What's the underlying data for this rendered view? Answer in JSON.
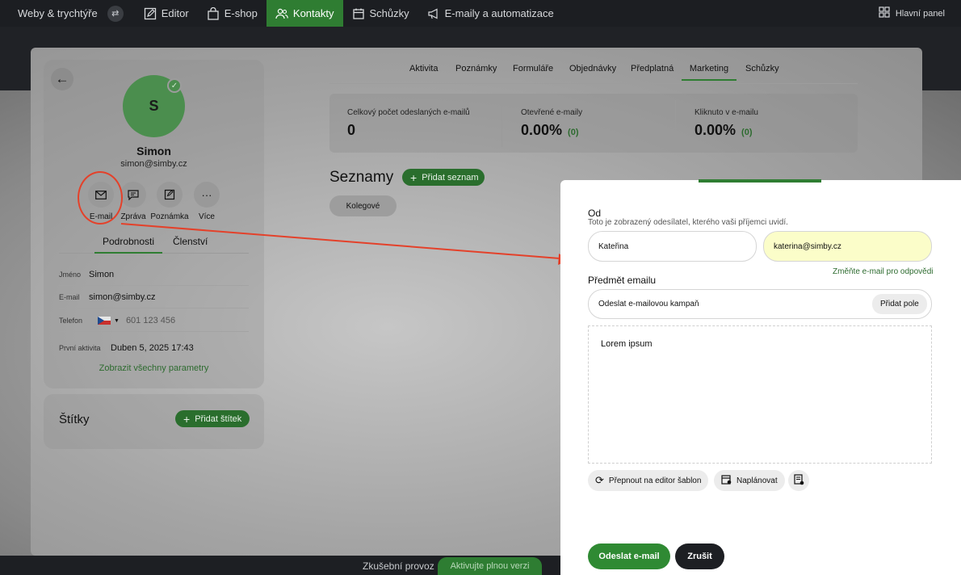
{
  "topbar": {
    "brand": "Weby & trychtýře",
    "nav": [
      {
        "label": "Editor",
        "icon": "edit-icon"
      },
      {
        "label": "E-shop",
        "icon": "shopping-bag-icon"
      },
      {
        "label": "Kontakty",
        "icon": "users-icon",
        "active": true
      },
      {
        "label": "Schůzky",
        "icon": "calendar-icon"
      },
      {
        "label": "E-maily a automatizace",
        "icon": "megaphone-icon"
      }
    ],
    "dashboard_label": "Hlavní panel"
  },
  "contact": {
    "initial": "S",
    "name": "Simon",
    "email": "simon@simby.cz",
    "actions": [
      {
        "label": "E-mail",
        "icon": "mail-icon"
      },
      {
        "label": "Zpráva",
        "icon": "chat-icon"
      },
      {
        "label": "Poznámka",
        "icon": "note-icon"
      },
      {
        "label": "Více",
        "icon": "more-icon"
      }
    ],
    "tabs": [
      "Podrobnosti",
      "Členství"
    ],
    "fields": {
      "name_label": "Jméno",
      "name_value": "Simon",
      "email_label": "E-mail",
      "email_value": "simon@simby.cz",
      "phone_label": "Telefon",
      "phone_placeholder": "601 123 456",
      "activity_label": "První aktivita",
      "activity_value": "Duben 5, 2025 17:43"
    },
    "show_all": "Zobrazit všechny parametry",
    "tags_title": "Štítky",
    "add_tag": "Přidat štítek"
  },
  "main": {
    "tabs": [
      "Aktivita",
      "Poznámky",
      "Formuláře",
      "Objednávky",
      "Předplatná",
      "Marketing",
      "Schůzky"
    ],
    "active_tab": "Marketing",
    "stats": [
      {
        "label": "Celkový počet odeslaných e-mailů",
        "value": "0",
        "count": ""
      },
      {
        "label": "Otevřené e-maily",
        "value": "0.00%",
        "count": "(0)"
      },
      {
        "label": "Kliknuto v e-mailu",
        "value": "0.00%",
        "count": "(0)"
      }
    ],
    "lists_title": "Seznamy",
    "add_list": "Přidat seznam",
    "list_chip": "Kolegové"
  },
  "compose": {
    "from_label": "Od",
    "from_hint": "Toto je zobrazený odesílatel, kterého vaši příjemci uvidí.",
    "sender_name": "Kateřina",
    "sender_email": "katerina@simby.cz",
    "change_reply": "Změňte e-mail pro odpovědi",
    "subject_label": "Předmět emailu",
    "subject_value": "Odeslat e-mailovou kampaň",
    "add_field": "Přidat pole",
    "body": "Lorem ipsum",
    "switch_editor": "Přepnout na editor šablon",
    "schedule": "Naplánovat",
    "send": "Odeslat e-mail",
    "cancel": "Zrušit"
  },
  "trial": {
    "label": "Zkušební provoz",
    "cta": "Aktivujte plnou verzi"
  },
  "colors": {
    "accent": "#2f7d32",
    "annotation": "#e4412a"
  }
}
